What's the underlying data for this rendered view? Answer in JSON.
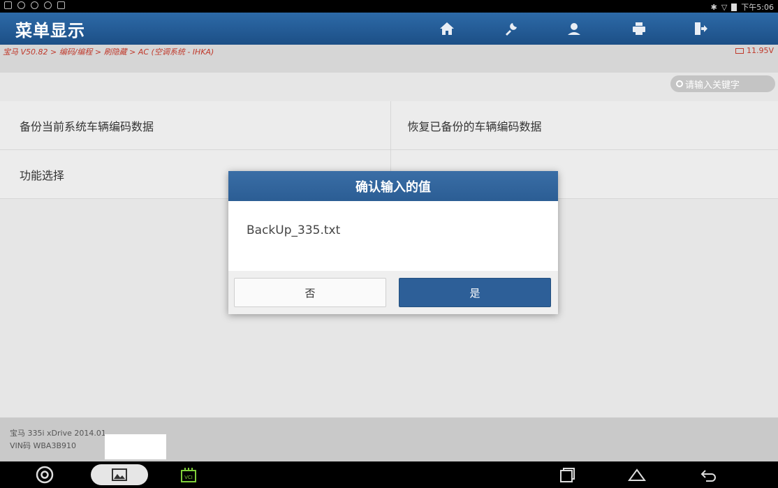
{
  "status_bar": {
    "time": "下午5:06"
  },
  "header": {
    "title": "菜单显示",
    "buttons": [
      "home-icon",
      "diagnose-icon",
      "user-icon",
      "print-icon",
      "exit-icon"
    ]
  },
  "breadcrumb": "宝马 V50.82 > 编码/编程 > 刷隐藏 > AC (空调系统 - IHKA)",
  "voltage": "11.95V",
  "search": {
    "placeholder": "请输入关键字"
  },
  "menu": {
    "rows": [
      [
        "备份当前系统车辆编码数据",
        "恢复已备份的车辆编码数据"
      ],
      [
        "功能选择",
        ""
      ]
    ]
  },
  "footer": {
    "vehicle": "宝马 335i xDrive 2014.01",
    "vin": "VIN码 WBA3B910"
  },
  "dialog": {
    "title": "确认输入的值",
    "value": "BackUp_335.txt",
    "no_label": "否",
    "yes_label": "是"
  },
  "colors": {
    "header_blue": "#2d6aa8",
    "primary_button": "#2d5f98",
    "breadcrumb_red": "#c0392b"
  }
}
